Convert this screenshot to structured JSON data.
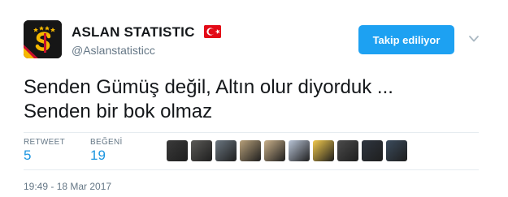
{
  "author": {
    "display_name": "ASLAN STATISTIC",
    "handle": "@Aslanstatisticc",
    "flag_icon": "turkey-flag-icon",
    "avatar_icon": "galatasaray-crest-icon"
  },
  "follow_button": {
    "label": "Takip ediliyor"
  },
  "tweet": {
    "lines": [
      "Senden Gümüş değil, Altın olur diyorduk ...",
      "Senden bir bok olmaz"
    ]
  },
  "stats": {
    "retweet_label": "RETWEET",
    "retweet_count": "5",
    "like_label": "BEĞENİ",
    "like_count": "19"
  },
  "likers": [
    {
      "name": "liker-avatar-1",
      "color": "#3a3a3a"
    },
    {
      "name": "liker-avatar-2",
      "color": "#5b5a57"
    },
    {
      "name": "liker-avatar-3",
      "color": "#6b7680"
    },
    {
      "name": "liker-avatar-4",
      "color": "#b7a07a"
    },
    {
      "name": "liker-avatar-5",
      "color": "#c9b08a"
    },
    {
      "name": "liker-avatar-6",
      "color": "#b9c4d6"
    },
    {
      "name": "liker-avatar-7",
      "color": "#f2c94c"
    },
    {
      "name": "liker-avatar-8",
      "color": "#4b4b4b"
    },
    {
      "name": "liker-avatar-9",
      "color": "#2f3640"
    },
    {
      "name": "liker-avatar-10",
      "color": "#3b4b5c"
    }
  ],
  "timestamp": "19:49 - 18 Mar 2017",
  "colors": {
    "accent": "#1da1f2",
    "link": "#1b95e0",
    "muted": "#657786",
    "text": "#14171a",
    "flag_red": "#e30a17",
    "crest_gold": "#f5b800",
    "crest_red": "#c8102e"
  }
}
